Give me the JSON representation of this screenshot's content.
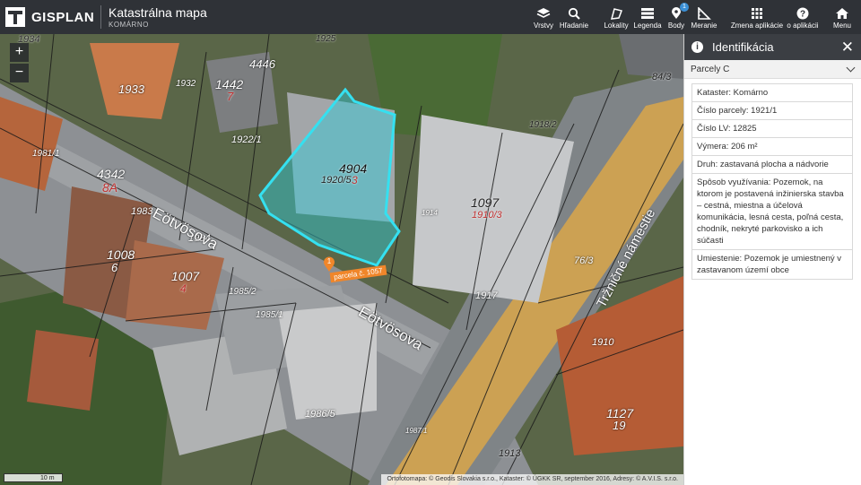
{
  "header": {
    "brand": "GISPLAN",
    "title": "Katastrálna mapa",
    "subtitle": "KOMÁRNO",
    "tools": [
      {
        "label": "Vrstvy",
        "icon": "layers-icon"
      },
      {
        "label": "Hľadanie",
        "icon": "search-icon"
      },
      {
        "label": "Lokality",
        "icon": "location-flag-icon"
      },
      {
        "label": "Legenda",
        "icon": "legend-list-icon"
      },
      {
        "label": "Body",
        "icon": "map-pin-icon",
        "badge": "1"
      },
      {
        "label": "Meranie",
        "icon": "ruler-icon"
      },
      {
        "label": "Zmena aplikácie",
        "icon": "app-grid-icon"
      },
      {
        "label": "o aplikácii",
        "icon": "help-icon"
      },
      {
        "label": "Menu",
        "icon": "home-icon"
      }
    ]
  },
  "map": {
    "zoom_in": "+",
    "zoom_out": "−",
    "scale": "10 m",
    "credits": "Ortofotomapa: © Geodis Slovakia s.r.o., Kataster: © ÚGKK SR, september 2016, Adresy: © A.V.I.S. s.r.o.",
    "marker_number": "1",
    "marker_label": "parcela č. 1057",
    "streets": [
      "Eötvösova",
      "Eötvösova",
      "Tržničné námestie"
    ],
    "parcel_labels": [
      "1934",
      "1933",
      "1925",
      "1442",
      "7",
      "4446",
      "1932",
      "1981/1",
      "4342",
      "8A",
      "1922/1",
      "1918/2",
      "4904",
      "3",
      "1920/5",
      "1097",
      "1910/3",
      "1983",
      "1984",
      "1008",
      "6",
      "1007",
      "4",
      "1985/2",
      "1985/1",
      "1917",
      "1914",
      "76/3",
      "1986/5",
      "1987/1",
      "1913",
      "1910",
      "1127",
      "19",
      "84/3"
    ],
    "colors": {
      "selection": "#35e0f0",
      "street_band": "#e8b04a",
      "marker": "#f0862a"
    }
  },
  "panel": {
    "title": "Identifikácia",
    "section": "Parcely C",
    "attributes": [
      "Kataster: Komárno",
      "Číslo parcely: 1921/1",
      "Číslo LV: 12825",
      "Výmera: 206 m²",
      "Druh: zastavaná plocha a nádvorie",
      "Spôsob využívania: Pozemok, na ktorom je postavená inžinierska stavba – cestná, miestna a účelová komunikácia, lesná cesta, poľná cesta, chodník, nekryté parkovisko a ich súčasti",
      "Umiestenie: Pozemok je umiestnený v zastavanom území obce"
    ]
  }
}
